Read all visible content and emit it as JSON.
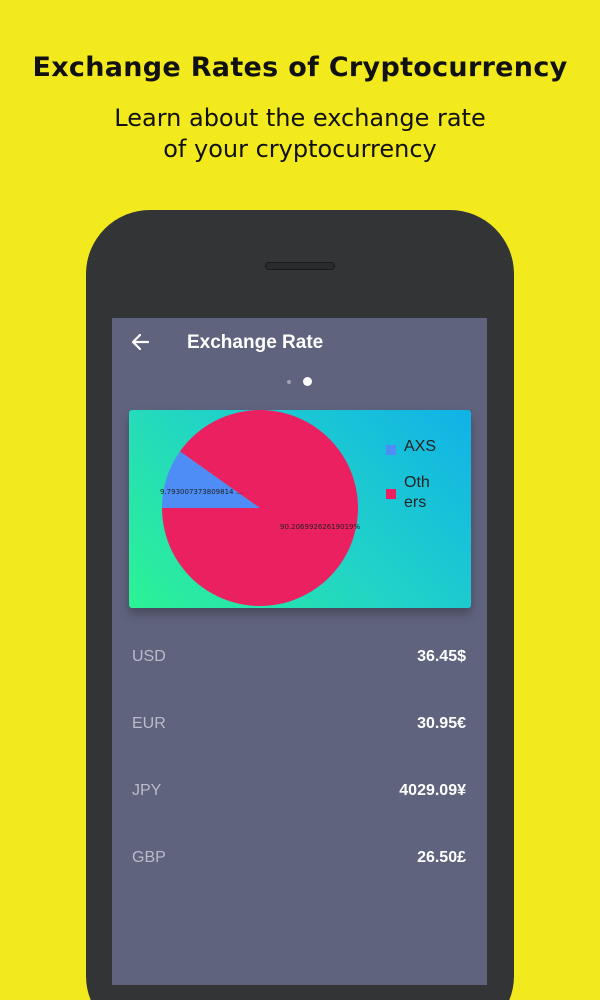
{
  "promo": {
    "title": "Exchange Rates of Cryptocurrency",
    "subtitle_line1": "Learn about the exchange rate",
    "subtitle_line2": "of your cryptocurrency"
  },
  "appbar": {
    "back_icon": "arrow-left-icon",
    "title": "Exchange Rate"
  },
  "pager": {
    "count": 2,
    "active": 2
  },
  "colors": {
    "background": "#F3EA1E",
    "screen": "#5F637D",
    "axs": "#4D8DF5",
    "others": "#EB2061"
  },
  "chart_data": {
    "type": "pie",
    "series": [
      {
        "name": "AXS",
        "value": 9.793007373809814,
        "label": "9.793007373809814 ..."
      },
      {
        "name": "Others",
        "value": 90.20699262619019,
        "label": "90.20699262619019%"
      }
    ],
    "legend": {
      "position": "right",
      "items": [
        "AXS",
        "Others"
      ]
    }
  },
  "rates": [
    {
      "code": "USD",
      "value": "36.45$"
    },
    {
      "code": "EUR",
      "value": "30.95€"
    },
    {
      "code": "JPY",
      "value": "4029.09¥"
    },
    {
      "code": "GBP",
      "value": "26.50£"
    }
  ]
}
